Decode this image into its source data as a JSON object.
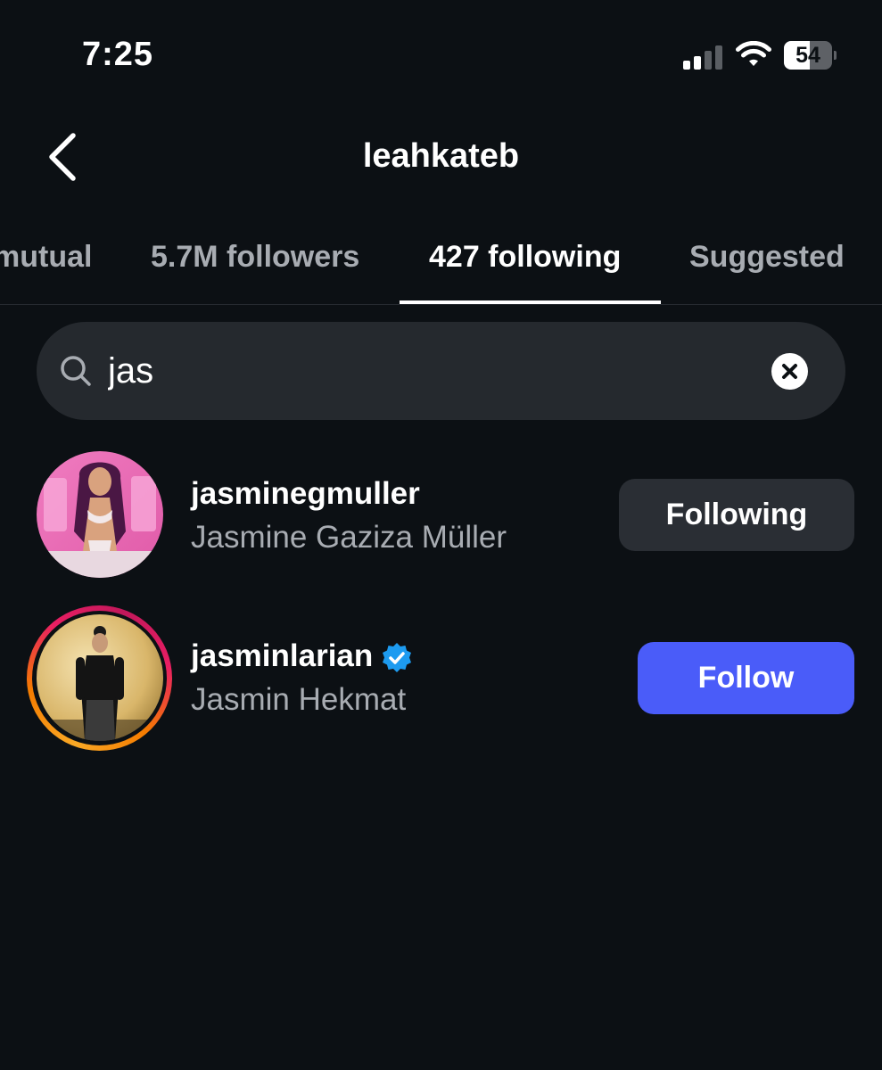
{
  "status_bar": {
    "time": "7:25",
    "battery": "54",
    "battery_level_percent": 54,
    "signal_bars_active": 2,
    "signal_bars_total": 4
  },
  "header": {
    "title": "leahkateb",
    "back_icon": "chevron-left-icon"
  },
  "tabs": [
    {
      "label": "mutual",
      "active": false
    },
    {
      "label": "5.7M followers",
      "active": false
    },
    {
      "label": "427 following",
      "active": true
    },
    {
      "label": "Suggested",
      "active": false
    }
  ],
  "search": {
    "value": "jas",
    "icon": "search-icon",
    "clear_icon": "close-circle-icon"
  },
  "results": [
    {
      "username": "jasminegmuller",
      "full_name": "Jasmine Gaziza Müller",
      "verified": false,
      "has_story_ring": false,
      "button_label": "Following"
    },
    {
      "username": "jasminlarian",
      "full_name": "Jasmin Hekmat",
      "verified": true,
      "has_story_ring": true,
      "button_label": "Follow"
    }
  ],
  "colors": {
    "background": "#0c1014",
    "follow_button": "#4a5cf9",
    "following_button": "#2a2e34",
    "verified_badge": "#1d9bf0",
    "secondary_text": "#a8acb2"
  }
}
